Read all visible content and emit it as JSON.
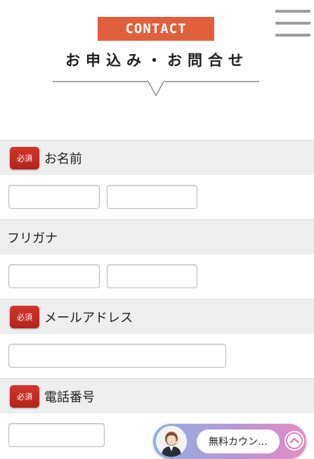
{
  "header": {
    "badge": "CONTACT",
    "title": "お申込み・お問合せ",
    "menu_icon": "hamburger-menu-icon"
  },
  "form": {
    "required_label": "必須",
    "fields": {
      "name": {
        "label": "お名前",
        "required": true
      },
      "furigana": {
        "label": "フリガナ",
        "required": false
      },
      "email": {
        "label": "メールアドレス",
        "required": true
      },
      "phone": {
        "label": "電話番号",
        "required": true
      }
    }
  },
  "chat_widget": {
    "label": "無料カウン…",
    "toggle_icon": "chevron-up-icon",
    "avatar_icon": "operator-avatar"
  },
  "colors": {
    "accent": "#e0603e",
    "required": "#c52b22",
    "section_bg": "#eeeeee"
  }
}
